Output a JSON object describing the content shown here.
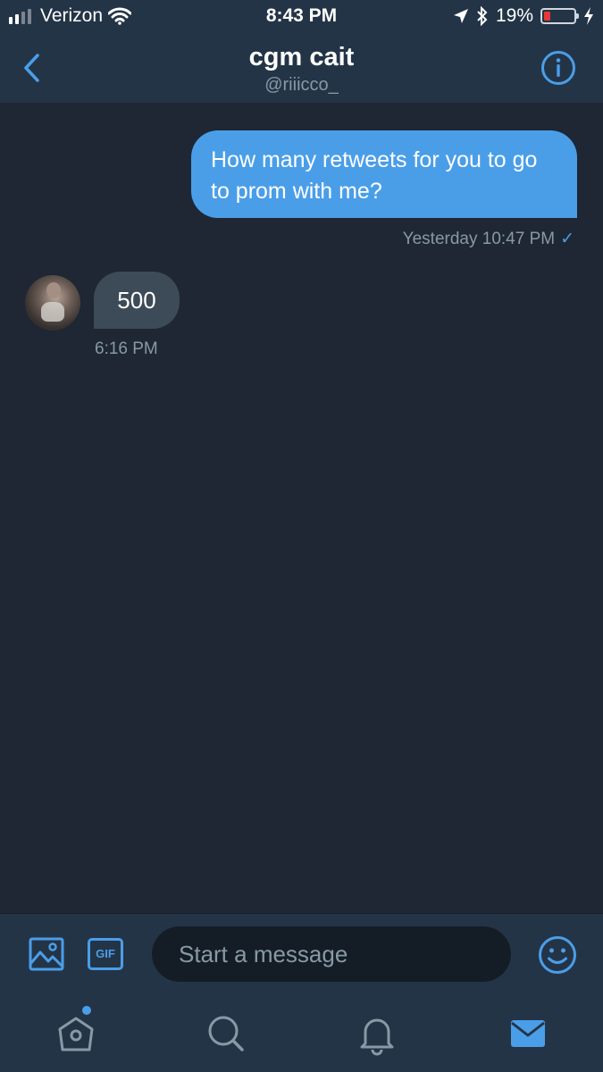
{
  "status_bar": {
    "carrier": "Verizon",
    "time": "8:43 PM",
    "battery_percent": "19%",
    "signal_bars": 2,
    "icons": [
      "signal-icon",
      "wifi-icon",
      "location-arrow-icon",
      "bluetooth-icon",
      "battery-icon",
      "charging-bolt-icon"
    ]
  },
  "header": {
    "name": "cgm cait",
    "handle": "@riiicco_",
    "back_icon": "chevron-left-icon",
    "info_icon": "info-icon"
  },
  "messages": [
    {
      "direction": "outgoing",
      "text": "How many retweets for you to go to prom with me?",
      "timestamp": "Yesterday 10:47 PM",
      "read_receipt": "✓"
    },
    {
      "direction": "incoming",
      "text": "500",
      "timestamp": "6:16 PM"
    }
  ],
  "composer": {
    "placeholder": "Start a message",
    "value": "",
    "gif_label": "GIF",
    "icons": [
      "image-icon",
      "gif-icon",
      "emoji-icon"
    ]
  },
  "tab_bar": {
    "tabs": [
      "home-icon",
      "search-icon",
      "notifications-icon",
      "messages-icon"
    ],
    "active": "messages-icon"
  },
  "colors": {
    "accent": "#4a9ee8",
    "background": "#1e2733",
    "header": "#243447",
    "incoming_bubble": "#3d4a57",
    "muted_text": "#8899a6"
  }
}
